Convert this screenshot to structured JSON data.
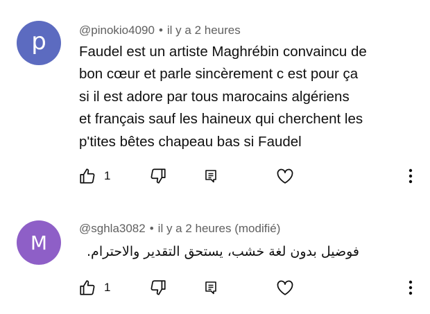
{
  "comments": [
    {
      "avatar_letter": "p",
      "avatar_color": "#5c6bc0",
      "handle": "@pinokio4090",
      "separator": "•",
      "time": "il y a 2 heures",
      "text": "Faudel est un artiste Maghrébin convaincu de\nbon cœur et parle sincèrement c est pour ça\nsi il est adore par tous marocains algériens\net français sauf les haineux qui cherchent les\np'tites bêtes chapeau bas si Faudel",
      "likes": "1",
      "icons": [
        "thumbs-up-icon",
        "thumbs-down-icon",
        "reply-icon",
        "heart-icon",
        "more-vert-icon"
      ]
    },
    {
      "avatar_letter": "M",
      "avatar_color": "#8e5fc7",
      "handle": "@sghla3082",
      "separator": "•",
      "time": "il y a 2 heures (modifié)",
      "text": "فوضيل بدون لغة خشب، يستحق التقدير والاحترام.",
      "likes": "1",
      "icons": [
        "thumbs-up-icon",
        "thumbs-down-icon",
        "reply-icon",
        "heart-icon",
        "more-vert-icon"
      ]
    }
  ]
}
